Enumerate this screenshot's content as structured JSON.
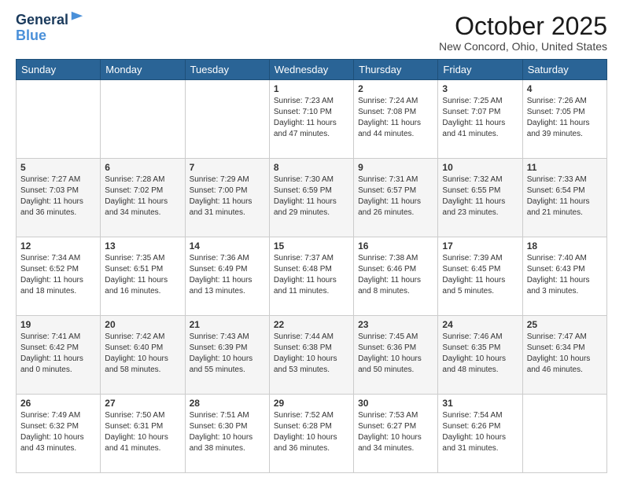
{
  "header": {
    "logo_line1": "General",
    "logo_line2": "Blue",
    "month_title": "October 2025",
    "subtitle": "New Concord, Ohio, United States"
  },
  "weekdays": [
    "Sunday",
    "Monday",
    "Tuesday",
    "Wednesday",
    "Thursday",
    "Friday",
    "Saturday"
  ],
  "weeks": [
    [
      {
        "day": "",
        "info": ""
      },
      {
        "day": "",
        "info": ""
      },
      {
        "day": "",
        "info": ""
      },
      {
        "day": "1",
        "info": "Sunrise: 7:23 AM\nSunset: 7:10 PM\nDaylight: 11 hours and 47 minutes."
      },
      {
        "day": "2",
        "info": "Sunrise: 7:24 AM\nSunset: 7:08 PM\nDaylight: 11 hours and 44 minutes."
      },
      {
        "day": "3",
        "info": "Sunrise: 7:25 AM\nSunset: 7:07 PM\nDaylight: 11 hours and 41 minutes."
      },
      {
        "day": "4",
        "info": "Sunrise: 7:26 AM\nSunset: 7:05 PM\nDaylight: 11 hours and 39 minutes."
      }
    ],
    [
      {
        "day": "5",
        "info": "Sunrise: 7:27 AM\nSunset: 7:03 PM\nDaylight: 11 hours and 36 minutes."
      },
      {
        "day": "6",
        "info": "Sunrise: 7:28 AM\nSunset: 7:02 PM\nDaylight: 11 hours and 34 minutes."
      },
      {
        "day": "7",
        "info": "Sunrise: 7:29 AM\nSunset: 7:00 PM\nDaylight: 11 hours and 31 minutes."
      },
      {
        "day": "8",
        "info": "Sunrise: 7:30 AM\nSunset: 6:59 PM\nDaylight: 11 hours and 29 minutes."
      },
      {
        "day": "9",
        "info": "Sunrise: 7:31 AM\nSunset: 6:57 PM\nDaylight: 11 hours and 26 minutes."
      },
      {
        "day": "10",
        "info": "Sunrise: 7:32 AM\nSunset: 6:55 PM\nDaylight: 11 hours and 23 minutes."
      },
      {
        "day": "11",
        "info": "Sunrise: 7:33 AM\nSunset: 6:54 PM\nDaylight: 11 hours and 21 minutes."
      }
    ],
    [
      {
        "day": "12",
        "info": "Sunrise: 7:34 AM\nSunset: 6:52 PM\nDaylight: 11 hours and 18 minutes."
      },
      {
        "day": "13",
        "info": "Sunrise: 7:35 AM\nSunset: 6:51 PM\nDaylight: 11 hours and 16 minutes."
      },
      {
        "day": "14",
        "info": "Sunrise: 7:36 AM\nSunset: 6:49 PM\nDaylight: 11 hours and 13 minutes."
      },
      {
        "day": "15",
        "info": "Sunrise: 7:37 AM\nSunset: 6:48 PM\nDaylight: 11 hours and 11 minutes."
      },
      {
        "day": "16",
        "info": "Sunrise: 7:38 AM\nSunset: 6:46 PM\nDaylight: 11 hours and 8 minutes."
      },
      {
        "day": "17",
        "info": "Sunrise: 7:39 AM\nSunset: 6:45 PM\nDaylight: 11 hours and 5 minutes."
      },
      {
        "day": "18",
        "info": "Sunrise: 7:40 AM\nSunset: 6:43 PM\nDaylight: 11 hours and 3 minutes."
      }
    ],
    [
      {
        "day": "19",
        "info": "Sunrise: 7:41 AM\nSunset: 6:42 PM\nDaylight: 11 hours and 0 minutes."
      },
      {
        "day": "20",
        "info": "Sunrise: 7:42 AM\nSunset: 6:40 PM\nDaylight: 10 hours and 58 minutes."
      },
      {
        "day": "21",
        "info": "Sunrise: 7:43 AM\nSunset: 6:39 PM\nDaylight: 10 hours and 55 minutes."
      },
      {
        "day": "22",
        "info": "Sunrise: 7:44 AM\nSunset: 6:38 PM\nDaylight: 10 hours and 53 minutes."
      },
      {
        "day": "23",
        "info": "Sunrise: 7:45 AM\nSunset: 6:36 PM\nDaylight: 10 hours and 50 minutes."
      },
      {
        "day": "24",
        "info": "Sunrise: 7:46 AM\nSunset: 6:35 PM\nDaylight: 10 hours and 48 minutes."
      },
      {
        "day": "25",
        "info": "Sunrise: 7:47 AM\nSunset: 6:34 PM\nDaylight: 10 hours and 46 minutes."
      }
    ],
    [
      {
        "day": "26",
        "info": "Sunrise: 7:49 AM\nSunset: 6:32 PM\nDaylight: 10 hours and 43 minutes."
      },
      {
        "day": "27",
        "info": "Sunrise: 7:50 AM\nSunset: 6:31 PM\nDaylight: 10 hours and 41 minutes."
      },
      {
        "day": "28",
        "info": "Sunrise: 7:51 AM\nSunset: 6:30 PM\nDaylight: 10 hours and 38 minutes."
      },
      {
        "day": "29",
        "info": "Sunrise: 7:52 AM\nSunset: 6:28 PM\nDaylight: 10 hours and 36 minutes."
      },
      {
        "day": "30",
        "info": "Sunrise: 7:53 AM\nSunset: 6:27 PM\nDaylight: 10 hours and 34 minutes."
      },
      {
        "day": "31",
        "info": "Sunrise: 7:54 AM\nSunset: 6:26 PM\nDaylight: 10 hours and 31 minutes."
      },
      {
        "day": "",
        "info": ""
      }
    ]
  ]
}
